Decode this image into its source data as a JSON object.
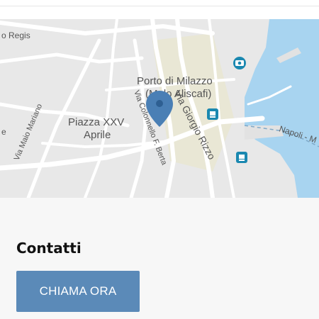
{
  "map": {
    "labels": {
      "road_regis": "o Regis",
      "port_name": "Porto di Milazzo",
      "port_sub": "(Molo Aliscafi)",
      "piazza_line1": "Piazza XXV",
      "piazza_line2": "Aprile",
      "via_colonnello": "Via Colonnello F. Berta",
      "via_giorgio": "Via Giorgio Rizzo",
      "via_maio": "Via Maio Mariano",
      "ferry_route": "Napoli - M",
      "edge_e": "e"
    },
    "colors": {
      "water": "#a8d4f0",
      "land": "#e8e8e8",
      "road": "#ffffff",
      "park": "#e8e6cf",
      "pin": "#4a7fb5",
      "transit_icon": "#1a88b0"
    }
  },
  "contacts": {
    "title": "Contatti",
    "call_button": "CHIAMA ORA"
  },
  "colors": {
    "button_bg": "#5b8ab8",
    "button_text": "#ffffff",
    "title_text": "#111111"
  }
}
